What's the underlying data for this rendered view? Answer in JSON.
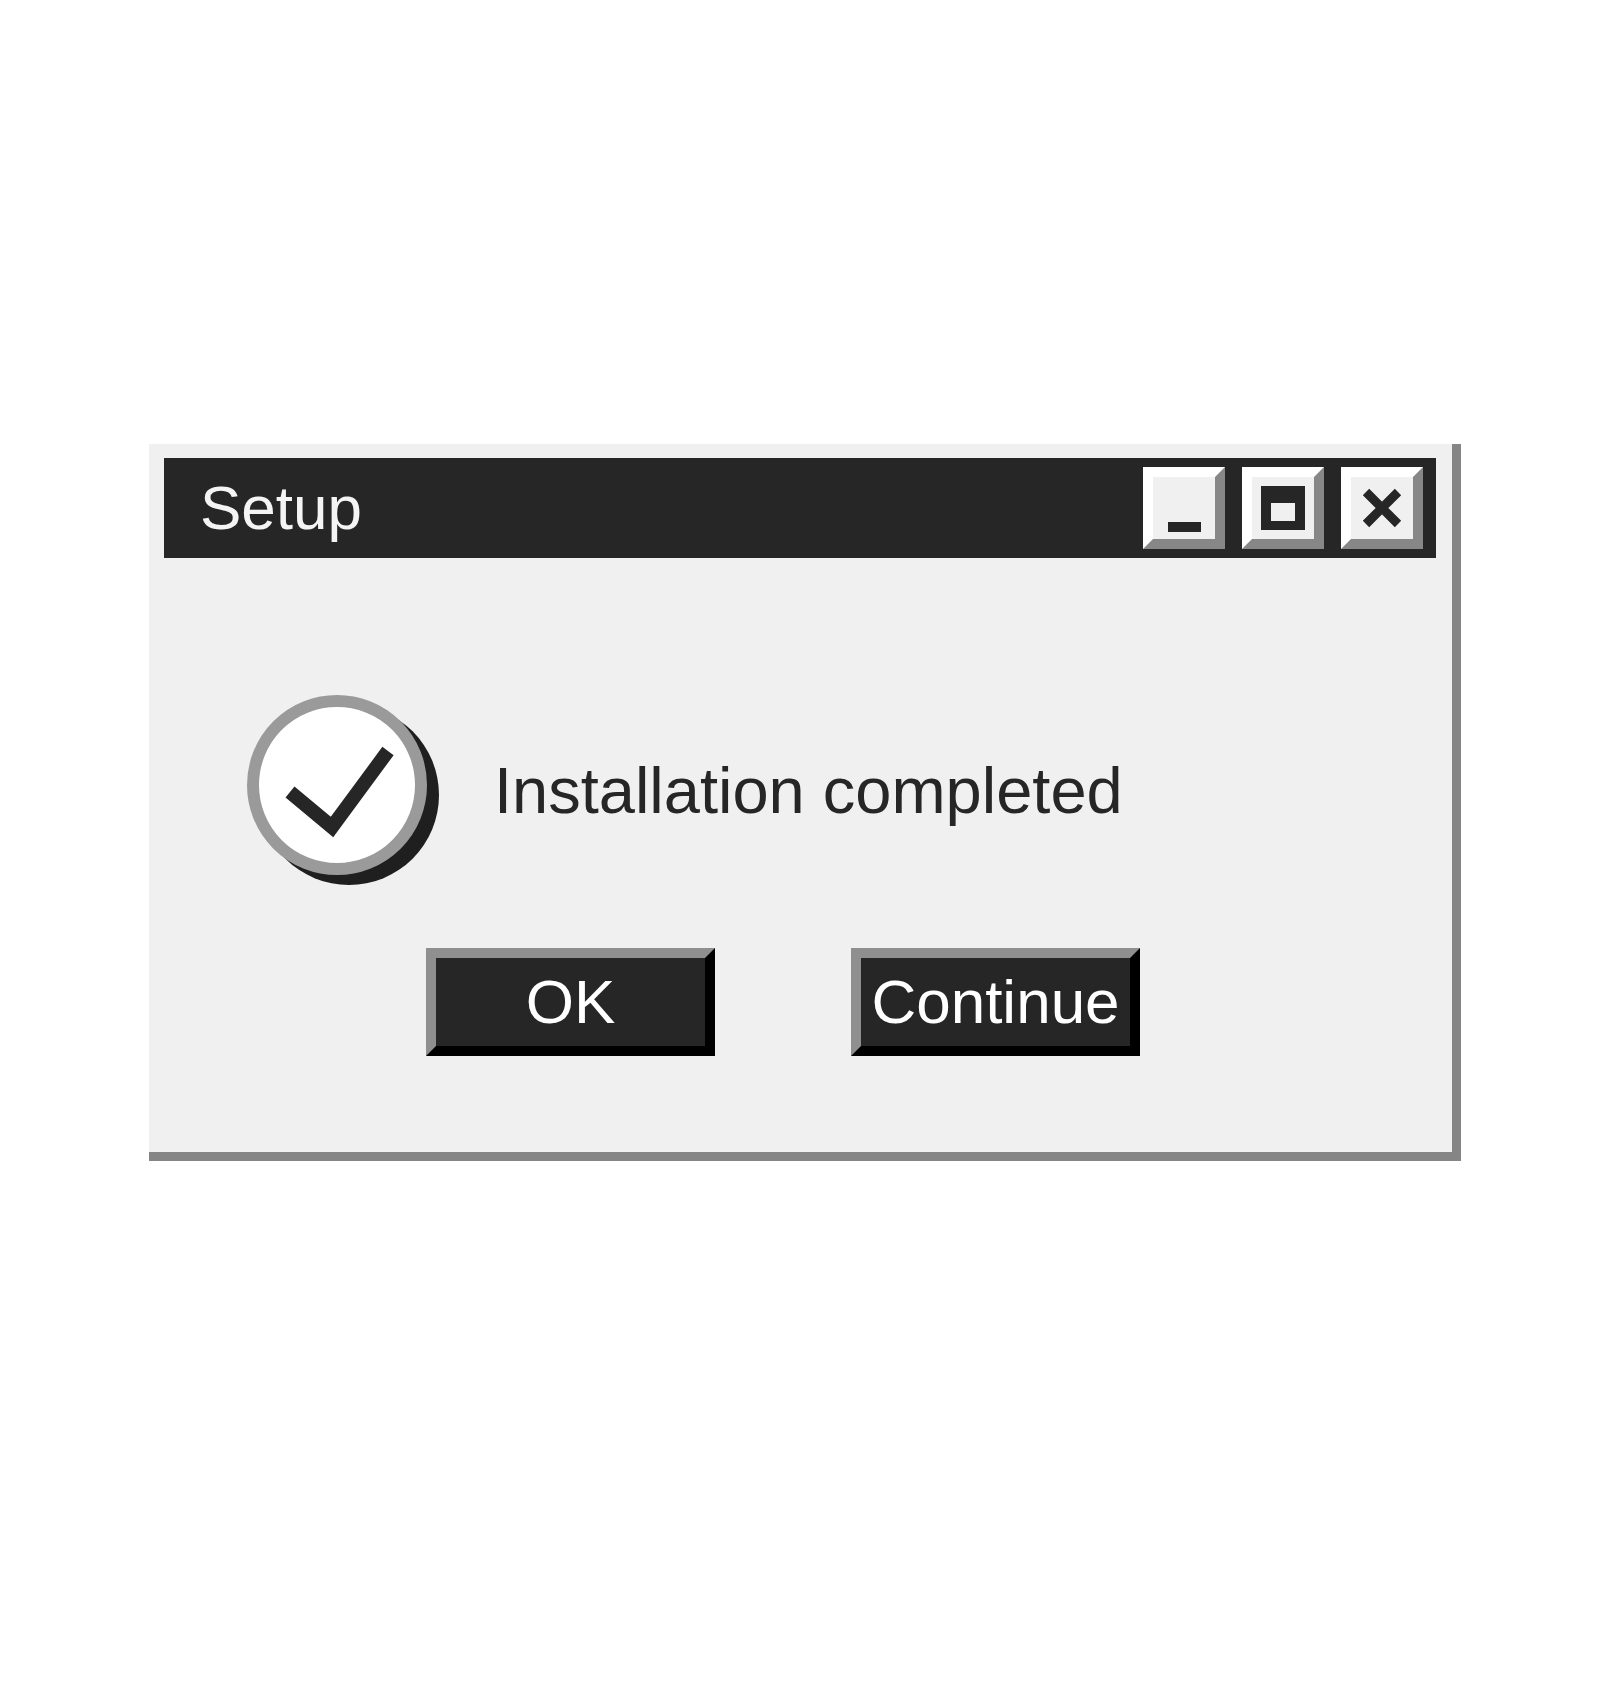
{
  "window": {
    "title": "Setup",
    "controls": [
      {
        "kind": "minimize"
      },
      {
        "kind": "maximize"
      },
      {
        "kind": "close"
      }
    ]
  },
  "message": {
    "kind": "success",
    "text": "Installation completed"
  },
  "buttons": [
    {
      "label": "OK"
    },
    {
      "label": "Continue"
    }
  ]
}
